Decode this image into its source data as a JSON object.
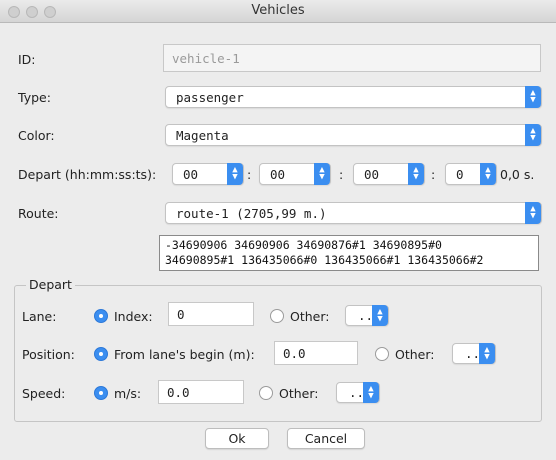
{
  "window": {
    "title": "Vehicles"
  },
  "form": {
    "id_label": "ID:",
    "id_value": "vehicle-1",
    "type_label": "Type:",
    "type_value": "passenger",
    "color_label": "Color:",
    "color_value": "Magenta",
    "depart_label": "Depart (hh:mm:ss:ts):",
    "depart": {
      "hh": "00",
      "mm": "00",
      "ss": "00",
      "ts": "0",
      "sep": ":",
      "seconds": "0,0 s."
    },
    "route_label": "Route:",
    "route_value": "route-1 (2705,99 m.)",
    "route_edges_line1": "-34690906 34690906 34690876#1 34690895#0",
    "route_edges_line2": "34690895#1 136435066#0 136435066#1 136435066#2"
  },
  "depart_group": {
    "title": "Depart",
    "lane": {
      "label": "Lane:",
      "index_label": "Index:",
      "index_value": "0",
      "other_label": "Other:",
      "other_value": ".."
    },
    "position": {
      "label": "Position:",
      "from_label": "From lane's begin (m):",
      "from_value": "0.0",
      "other_label": "Other:",
      "other_value": ".."
    },
    "speed": {
      "label": "Speed:",
      "ms_label": "m/s:",
      "ms_value": "0.0",
      "other_label": "Other:",
      "other_value": ".."
    }
  },
  "buttons": {
    "ok": "Ok",
    "cancel": "Cancel"
  }
}
